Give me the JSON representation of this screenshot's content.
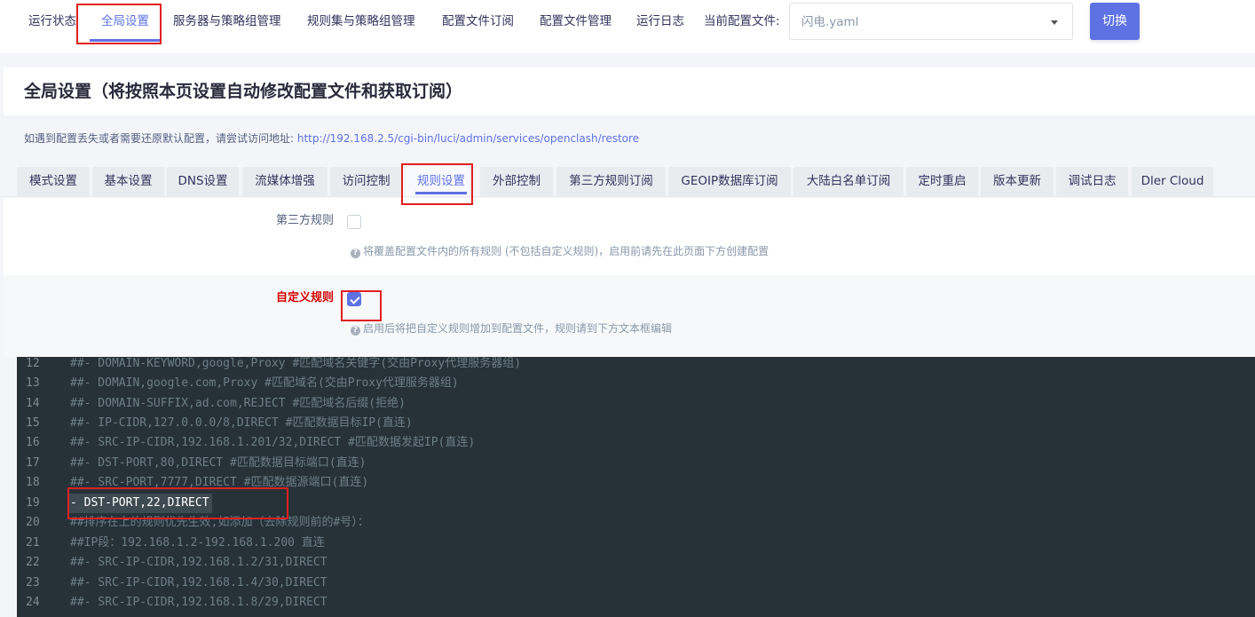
{
  "nav": {
    "items": [
      {
        "label": "运行状态"
      },
      {
        "label": "全局设置"
      },
      {
        "label": "服务器与策略组管理"
      },
      {
        "label": "规则集与策略组管理"
      },
      {
        "label": "配置文件订阅"
      },
      {
        "label": "配置文件管理"
      },
      {
        "label": "运行日志"
      }
    ],
    "config_label": "当前配置文件:",
    "config_value": "闪电.yaml",
    "switch_label": "切换"
  },
  "page": {
    "title": "全局设置（将按照本页设置自动修改配置文件和获取订阅）",
    "restore_note": "如遇到配置丢失或者需要还原默认配置，请尝试访问地址:",
    "restore_link": "http://192.168.2.5/cgi-bin/luci/admin/services/openclash/restore"
  },
  "subtabs": [
    {
      "label": "模式设置"
    },
    {
      "label": "基本设置"
    },
    {
      "label": "DNS设置"
    },
    {
      "label": "流媒体增强"
    },
    {
      "label": "访问控制"
    },
    {
      "label": "规则设置"
    },
    {
      "label": "外部控制"
    },
    {
      "label": "第三方规则订阅"
    },
    {
      "label": "GEOIP数据库订阅"
    },
    {
      "label": "大陆白名单订阅"
    },
    {
      "label": "定时重启"
    },
    {
      "label": "版本更新"
    },
    {
      "label": "调试日志"
    },
    {
      "label": "Dler Cloud"
    }
  ],
  "form": {
    "third_party_rules": {
      "label": "第三方规则",
      "checked": false,
      "hint": "将覆盖配置文件内的所有规则 (不包括自定义规则)，启用前请先在此页面下方创建配置"
    },
    "custom_rules": {
      "label": "自定义规则",
      "checked": true,
      "hint": "启用后将把自定义规则增加到配置文件，规则请到下方文本框编辑"
    }
  },
  "editor": {
    "lines": [
      {
        "num": "12",
        "text": "##- DOMAIN-KEYWORD,google,Proxy #匹配域名关键字(交由Proxy代理服务器组)"
      },
      {
        "num": "13",
        "text": "##- DOMAIN,google.com,Proxy #匹配域名(交由Proxy代理服务器组)"
      },
      {
        "num": "14",
        "text": "##- DOMAIN-SUFFIX,ad.com,REJECT #匹配域名后缀(拒绝)"
      },
      {
        "num": "15",
        "text": "##- IP-CIDR,127.0.0.0/8,DIRECT #匹配数据目标IP(直连)"
      },
      {
        "num": "16",
        "text": "##- SRC-IP-CIDR,192.168.1.201/32,DIRECT #匹配数据发起IP(直连)"
      },
      {
        "num": "17",
        "text": "##- DST-PORT,80,DIRECT #匹配数据目标端口(直连)"
      },
      {
        "num": "18",
        "text": "##- SRC-PORT,7777,DIRECT #匹配数据源端口(直连)"
      },
      {
        "num": "19",
        "text": "- DST-PORT,22,DIRECT"
      },
      {
        "num": "20",
        "text": "##排序在上的规则优先生效,如添加（去除规则前的#号）："
      },
      {
        "num": "21",
        "text": "##IP段：192.168.1.2-192.168.1.200 直连"
      },
      {
        "num": "22",
        "text": "##- SRC-IP-CIDR,192.168.1.2/31,DIRECT"
      },
      {
        "num": "23",
        "text": "##- SRC-IP-CIDR,192.168.1.4/30,DIRECT"
      },
      {
        "num": "24",
        "text": "##- SRC-IP-CIDR,192.168.1.8/29,DIRECT"
      }
    ]
  }
}
